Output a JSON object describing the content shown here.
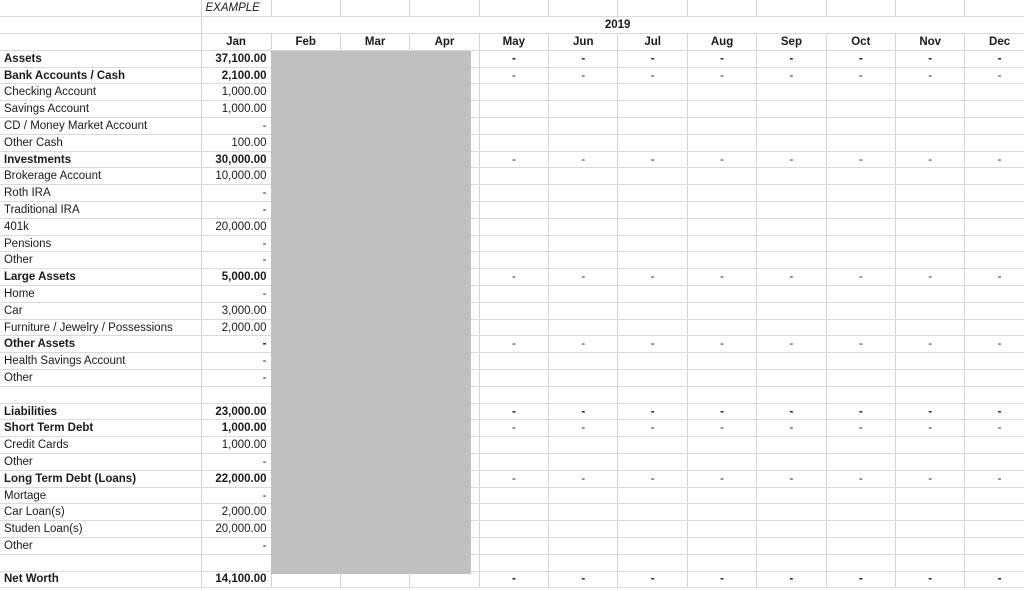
{
  "meta": {
    "example_tag": "EXAMPLE",
    "year": "2019"
  },
  "colors": {
    "assets_header": "#5f9338",
    "assets_value": "#d9ead3",
    "liabilities_header": "#e01b1b",
    "liabilities_value": "#fb7c7c",
    "networth_header": "#26456e",
    "networth_value": "#c3d7ef",
    "month_header": "#1f3864",
    "year_bar": "#3f3f3f",
    "subtotal_row": "#f2f2f2",
    "mask": "#c0c0c0"
  },
  "months": [
    "Jan",
    "Feb",
    "Mar",
    "Apr",
    "May",
    "Jun",
    "Jul",
    "Aug",
    "Sep",
    "Oct",
    "Nov",
    "Dec"
  ],
  "empty_marker": "-",
  "rows": [
    {
      "label": "Assets",
      "value": "37,100.00",
      "kind": "section-assets",
      "months": [
        "-",
        "-",
        "-",
        "-",
        "-",
        "-",
        "-",
        "-"
      ]
    },
    {
      "label": "Bank Accounts / Cash",
      "value": "2,100.00",
      "kind": "subtotal",
      "months": [
        "-",
        "-",
        "-",
        "-",
        "-",
        "-",
        "-",
        "-"
      ]
    },
    {
      "label": "Checking Account",
      "value": "1,000.00",
      "kind": "item",
      "months": [
        "",
        "",
        "",
        "",
        "",
        "",
        "",
        ""
      ]
    },
    {
      "label": "Savings Account",
      "value": "1,000.00",
      "kind": "item",
      "months": [
        "",
        "",
        "",
        "",
        "",
        "",
        "",
        ""
      ]
    },
    {
      "label": "CD / Money Market Account",
      "value": "-",
      "kind": "item",
      "months": [
        "",
        "",
        "",
        "",
        "",
        "",
        "",
        ""
      ]
    },
    {
      "label": "Other Cash",
      "value": "100.00",
      "kind": "item",
      "months": [
        "",
        "",
        "",
        "",
        "",
        "",
        "",
        ""
      ]
    },
    {
      "label": "Investments",
      "value": "30,000.00",
      "kind": "subtotal",
      "months": [
        "-",
        "-",
        "-",
        "-",
        "-",
        "-",
        "-",
        "-"
      ]
    },
    {
      "label": "Brokerage Account",
      "value": "10,000.00",
      "kind": "item",
      "months": [
        "",
        "",
        "",
        "",
        "",
        "",
        "",
        ""
      ]
    },
    {
      "label": "Roth IRA",
      "value": "-",
      "kind": "item",
      "months": [
        "",
        "",
        "",
        "",
        "",
        "",
        "",
        ""
      ]
    },
    {
      "label": "Traditional IRA",
      "value": "-",
      "kind": "item",
      "months": [
        "",
        "",
        "",
        "",
        "",
        "",
        "",
        ""
      ]
    },
    {
      "label": "401k",
      "value": "20,000.00",
      "kind": "item",
      "months": [
        "",
        "",
        "",
        "",
        "",
        "",
        "",
        ""
      ]
    },
    {
      "label": "Pensions",
      "value": "-",
      "kind": "item",
      "months": [
        "",
        "",
        "",
        "",
        "",
        "",
        "",
        ""
      ]
    },
    {
      "label": "Other",
      "value": "-",
      "kind": "item",
      "months": [
        "",
        "",
        "",
        "",
        "",
        "",
        "",
        ""
      ]
    },
    {
      "label": "Large Assets",
      "value": "5,000.00",
      "kind": "subtotal",
      "months": [
        "-",
        "-",
        "-",
        "-",
        "-",
        "-",
        "-",
        "-"
      ]
    },
    {
      "label": "Home",
      "value": "-",
      "kind": "item",
      "months": [
        "",
        "",
        "",
        "",
        "",
        "",
        "",
        ""
      ]
    },
    {
      "label": "Car",
      "value": "3,000.00",
      "kind": "item",
      "months": [
        "",
        "",
        "",
        "",
        "",
        "",
        "",
        ""
      ]
    },
    {
      "label": "Furniture / Jewelry / Possessions",
      "value": "2,000.00",
      "kind": "item",
      "months": [
        "",
        "",
        "",
        "",
        "",
        "",
        "",
        ""
      ]
    },
    {
      "label": "Other Assets",
      "value": "-",
      "kind": "subtotal",
      "months": [
        "-",
        "-",
        "-",
        "-",
        "-",
        "-",
        "-",
        "-"
      ]
    },
    {
      "label": "Health Savings Account",
      "value": "-",
      "kind": "item",
      "months": [
        "",
        "",
        "",
        "",
        "",
        "",
        "",
        ""
      ]
    },
    {
      "label": "Other",
      "value": "-",
      "kind": "item",
      "months": [
        "",
        "",
        "",
        "",
        "",
        "",
        "",
        ""
      ]
    },
    {
      "label": "",
      "value": "",
      "kind": "spacer",
      "months": [
        "",
        "",
        "",
        "",
        "",
        "",
        "",
        ""
      ]
    },
    {
      "label": "Liabilities",
      "value": "23,000.00",
      "kind": "section-liabilities",
      "months": [
        "-",
        "-",
        "-",
        "-",
        "-",
        "-",
        "-",
        "-"
      ]
    },
    {
      "label": "Short Term Debt",
      "value": "1,000.00",
      "kind": "subtotal",
      "months": [
        "-",
        "-",
        "-",
        "-",
        "-",
        "-",
        "-",
        "-"
      ]
    },
    {
      "label": "Credit Cards",
      "value": "1,000.00",
      "kind": "item",
      "months": [
        "",
        "",
        "",
        "",
        "",
        "",
        "",
        ""
      ]
    },
    {
      "label": "Other",
      "value": "-",
      "kind": "item",
      "months": [
        "",
        "",
        "",
        "",
        "",
        "",
        "",
        ""
      ]
    },
    {
      "label": "Long Term Debt (Loans)",
      "value": "22,000.00",
      "kind": "subtotal",
      "months": [
        "-",
        "-",
        "-",
        "-",
        "-",
        "-",
        "-",
        "-"
      ]
    },
    {
      "label": "Mortage",
      "value": "-",
      "kind": "item",
      "months": [
        "",
        "",
        "",
        "",
        "",
        "",
        "",
        ""
      ]
    },
    {
      "label": "Car Loan(s)",
      "value": "2,000.00",
      "kind": "item",
      "months": [
        "",
        "",
        "",
        "",
        "",
        "",
        "",
        ""
      ]
    },
    {
      "label": "Studen Loan(s)",
      "value": "20,000.00",
      "kind": "item",
      "months": [
        "",
        "",
        "",
        "",
        "",
        "",
        "",
        ""
      ]
    },
    {
      "label": "Other",
      "value": "-",
      "kind": "item",
      "months": [
        "",
        "",
        "",
        "",
        "",
        "",
        "",
        ""
      ]
    },
    {
      "label": "",
      "value": "",
      "kind": "spacer",
      "months": [
        "",
        "",
        "",
        "",
        "",
        "",
        "",
        ""
      ]
    },
    {
      "label": "Net Worth",
      "value": "14,100.00",
      "kind": "section-networth",
      "months": [
        "-",
        "-",
        "-",
        "-",
        "-",
        "-",
        "-",
        "-"
      ]
    }
  ]
}
